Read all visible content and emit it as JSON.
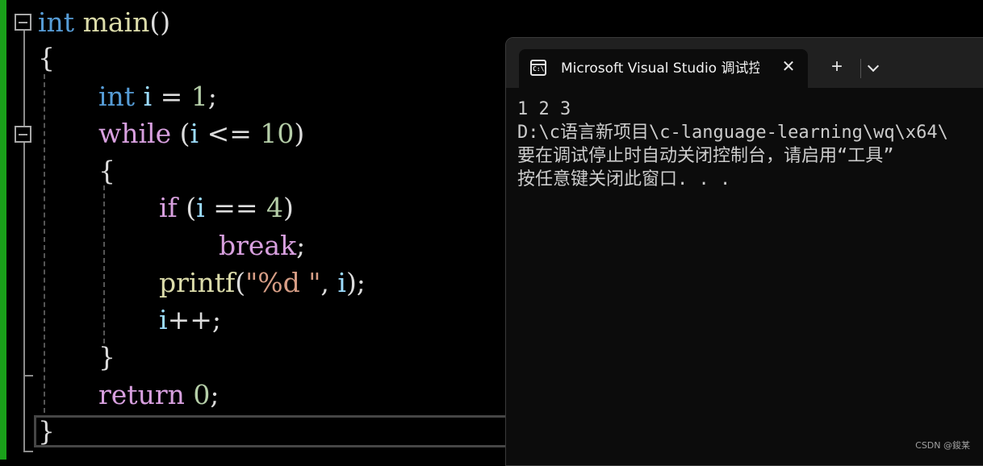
{
  "editor": {
    "lines": [
      {
        "tokens": [
          {
            "t": "int",
            "c": "kw-blue"
          },
          {
            "t": " ",
            "c": "punc"
          },
          {
            "t": "main",
            "c": "fn"
          },
          {
            "t": "()",
            "c": "punc"
          }
        ]
      },
      {
        "tokens": [
          {
            "t": "{",
            "c": "punc"
          }
        ]
      },
      {
        "tokens": [
          {
            "t": "int",
            "c": "kw-blue"
          },
          {
            "t": " ",
            "c": "punc"
          },
          {
            "t": "i",
            "c": "var"
          },
          {
            "t": " = ",
            "c": "punc"
          },
          {
            "t": "1",
            "c": "num"
          },
          {
            "t": ";",
            "c": "punc"
          }
        ]
      },
      {
        "tokens": [
          {
            "t": "while",
            "c": "kw-purple"
          },
          {
            "t": " (",
            "c": "punc"
          },
          {
            "t": "i",
            "c": "var"
          },
          {
            "t": " <= ",
            "c": "punc"
          },
          {
            "t": "10",
            "c": "num"
          },
          {
            "t": ")",
            "c": "punc"
          }
        ]
      },
      {
        "tokens": [
          {
            "t": "{",
            "c": "punc"
          }
        ]
      },
      {
        "tokens": [
          {
            "t": "if",
            "c": "kw-purple"
          },
          {
            "t": " (",
            "c": "punc"
          },
          {
            "t": "i",
            "c": "var"
          },
          {
            "t": " == ",
            "c": "punc"
          },
          {
            "t": "4",
            "c": "num"
          },
          {
            "t": ")",
            "c": "punc"
          }
        ]
      },
      {
        "tokens": [
          {
            "t": "break",
            "c": "kw-purple"
          },
          {
            "t": ";",
            "c": "punc"
          }
        ]
      },
      {
        "tokens": [
          {
            "t": "printf",
            "c": "fn"
          },
          {
            "t": "(",
            "c": "punc"
          },
          {
            "t": "\"%d \"",
            "c": "str"
          },
          {
            "t": ", ",
            "c": "punc"
          },
          {
            "t": "i",
            "c": "var"
          },
          {
            "t": ");",
            "c": "punc"
          }
        ]
      },
      {
        "tokens": [
          {
            "t": "i",
            "c": "var"
          },
          {
            "t": "++;",
            "c": "punc"
          }
        ]
      },
      {
        "tokens": [
          {
            "t": "}",
            "c": "punc"
          }
        ]
      },
      {
        "tokens": [
          {
            "t": "return",
            "c": "kw-purple"
          },
          {
            "t": " ",
            "c": "punc"
          },
          {
            "t": "0",
            "c": "num"
          },
          {
            "t": ";",
            "c": "punc"
          }
        ]
      },
      {
        "tokens": [
          {
            "t": "}",
            "c": "punc"
          }
        ]
      }
    ]
  },
  "console": {
    "tab_title": "Microsoft Visual Studio 调试控制台",
    "tab_icon_label": "C:\\",
    "close_glyph": "✕",
    "new_tab_glyph": "+",
    "output": [
      "1 2 3",
      "D:\\c语言新项目\\c-language-learning\\wq\\x64\\",
      "要在调试停止时自动关闭控制台，请启用“工具”",
      "按任意键关闭此窗口. . ."
    ]
  },
  "watermark": "CSDN @鋑某",
  "colors": {
    "keyword_blue": "#569cd6",
    "keyword_purple": "#d8a0df",
    "function": "#dcdcaa",
    "variable": "#9cdcfe",
    "number": "#b5cea8",
    "string": "#d69d85",
    "gutter_bar": "#1aa01a"
  }
}
